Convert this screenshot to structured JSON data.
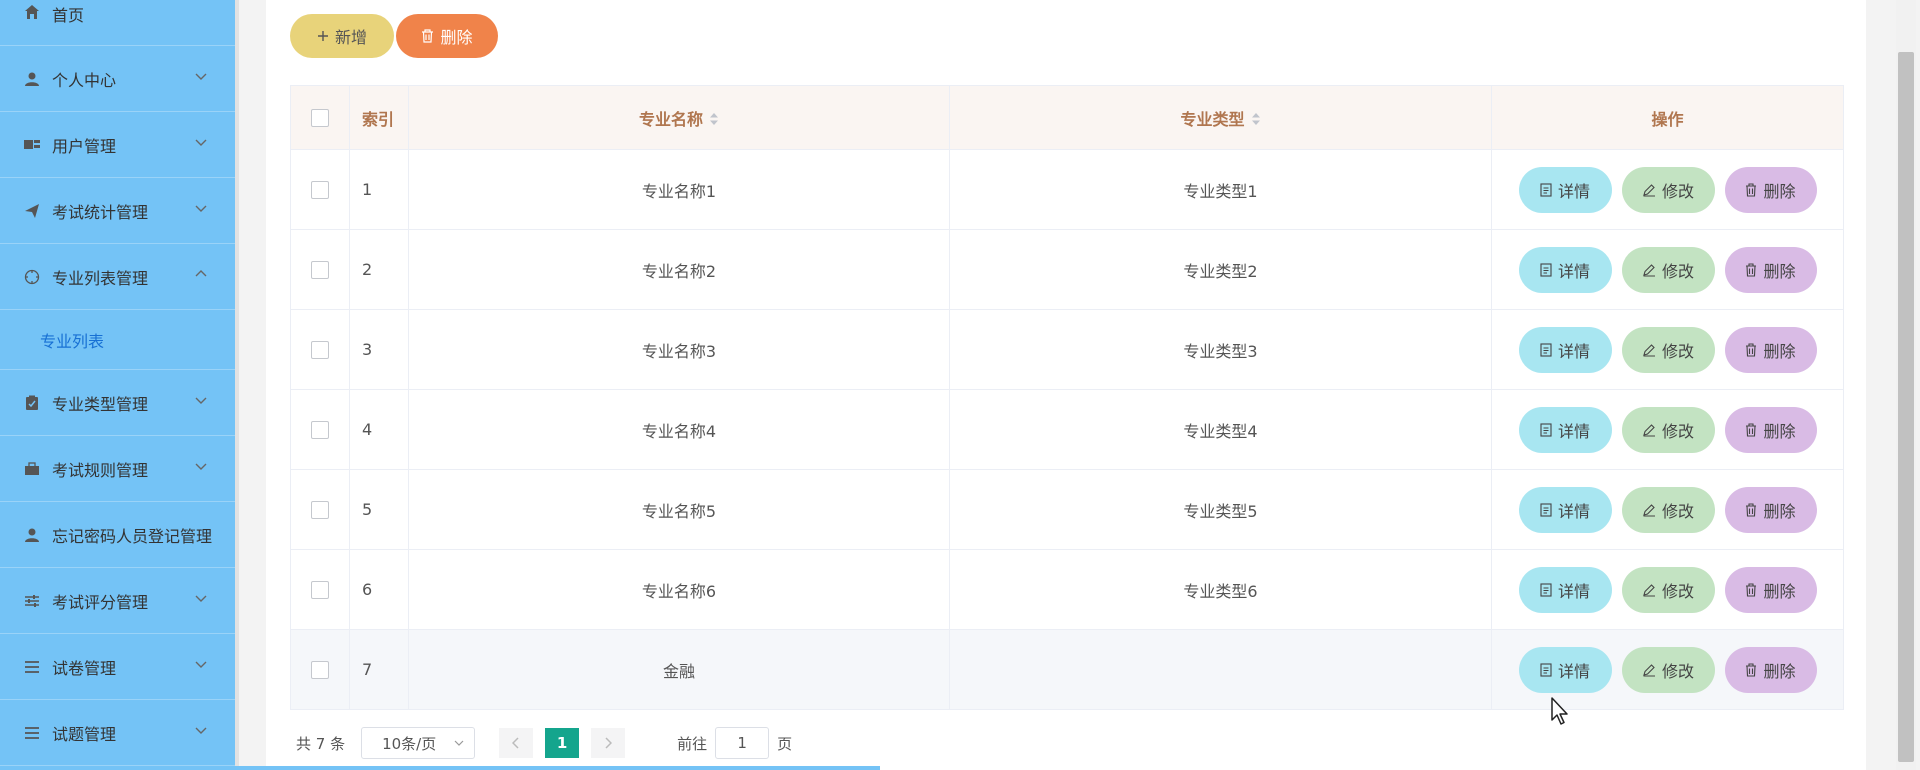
{
  "sidebar": {
    "items": [
      {
        "label": "首页",
        "icon": "home-icon"
      },
      {
        "label": "个人中心",
        "icon": "user-icon"
      },
      {
        "label": "用户管理",
        "icon": "users-icon"
      },
      {
        "label": "考试统计管理",
        "icon": "send-icon"
      },
      {
        "label": "专业列表管理",
        "icon": "target-icon"
      },
      {
        "label": "专业列表",
        "icon": ""
      },
      {
        "label": "专业类型管理",
        "icon": "clipboard-icon"
      },
      {
        "label": "考试规则管理",
        "icon": "briefcase-icon"
      },
      {
        "label": "忘记密码人员登记管理",
        "icon": "user-icon"
      },
      {
        "label": "考试评分管理",
        "icon": "sliders-icon"
      },
      {
        "label": "试卷管理",
        "icon": "menu-icon"
      },
      {
        "label": "试题管理",
        "icon": "menu-icon"
      }
    ]
  },
  "toolbar": {
    "add_label": "新增",
    "delete_label": "删除"
  },
  "table": {
    "headers": {
      "index": "索引",
      "name": "专业名称",
      "type": "专业类型",
      "ops": "操作"
    },
    "rows": [
      {
        "index": "1",
        "name": "专业名称1",
        "type": "专业类型1"
      },
      {
        "index": "2",
        "name": "专业名称2",
        "type": "专业类型2"
      },
      {
        "index": "3",
        "name": "专业名称3",
        "type": "专业类型3"
      },
      {
        "index": "4",
        "name": "专业名称4",
        "type": "专业类型4"
      },
      {
        "index": "5",
        "name": "专业名称5",
        "type": "专业类型5"
      },
      {
        "index": "6",
        "name": "专业名称6",
        "type": "专业类型6"
      },
      {
        "index": "7",
        "name": "金融",
        "type": ""
      }
    ],
    "actions": {
      "detail": "详情",
      "edit": "修改",
      "delete": "删除"
    }
  },
  "pagination": {
    "total_text": "共 7 条",
    "page_size": "10条/页",
    "current_page": "1",
    "goto_label": "前往",
    "goto_value": "1",
    "page_suffix": "页"
  },
  "colors": {
    "sidebar_bg": "#74c3f6",
    "add_button": "#e8d37a",
    "delete_button": "#f0834a",
    "detail_pill": "#a8e6f1",
    "edit_pill": "#c3e3c2",
    "delete_pill": "#d9bbe5",
    "header_text": "#b0764f",
    "current_page": "#14a58d"
  }
}
